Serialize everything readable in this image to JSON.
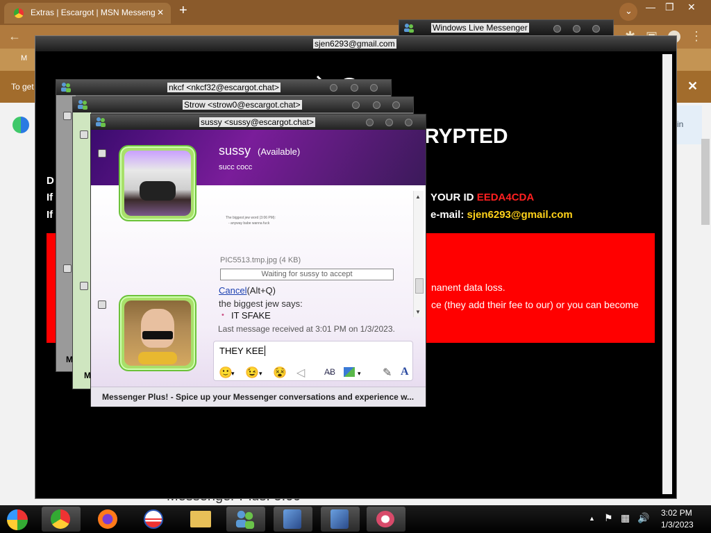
{
  "browser": {
    "tab_title": "Extras | Escargot | MSN Messeng",
    "tab_close": "✕",
    "new_tab": "+",
    "infobar_text": "To get",
    "infobar_close": "✕",
    "bookmarks_fragment": "M",
    "page_fragment": "in"
  },
  "wlm_window": {
    "title": "Windows Live Messenger"
  },
  "main_window": {
    "title": "sjen6293@gmail.com",
    "heading": "RYPTED",
    "lines": [
      {
        "prefix": "D"
      },
      {
        "prefix": "If",
        "text": "YOUR ID ",
        "id": "EEDA4CDA"
      },
      {
        "prefix": "If",
        "text": "e-mail: ",
        "email": "sjen6293@gmail.com"
      }
    ],
    "redbox": {
      "line1": "nanent data loss.",
      "line2": "ce (they add their fee to our) or you can become"
    },
    "behind_text": "Messenger Plus! 5.09"
  },
  "chat_windows": [
    {
      "title": "nkcf <nkcf32@escargot.chat>"
    },
    {
      "title": "Strow <strow0@escargot.chat>"
    },
    {
      "title": "sussy <sussy@escargot.chat>"
    }
  ],
  "chat": {
    "contact_name": "sussy",
    "status": "(Available)",
    "personal_message": "succ cocc",
    "image_caption_line1": "The biggest jew word (3:06 PM):",
    "image_caption_line2": "- anyway babe wanna fuck",
    "file_name": "PIC5513.tmp.jpg (4 KB)",
    "waiting_text": "Waiting for sussy to accept",
    "cancel_link": "Cancel",
    "cancel_shortcut": "(Alt+Q)",
    "sender_line": "the biggest jew says:",
    "message_bullet": "•",
    "message": "IT SFAKE",
    "last_received": "Last message received at 3:01 PM on 1/3/2023.",
    "input_value": "THEY KEE",
    "plus_bar": "Messenger Plus! - Spice up your Messenger conversations and experience w...",
    "side_letter_1": "M",
    "side_letter_2": "M"
  },
  "taskbar": {
    "time": "3:02 PM",
    "date": "1/3/2023",
    "tray_chevron": "▲"
  }
}
